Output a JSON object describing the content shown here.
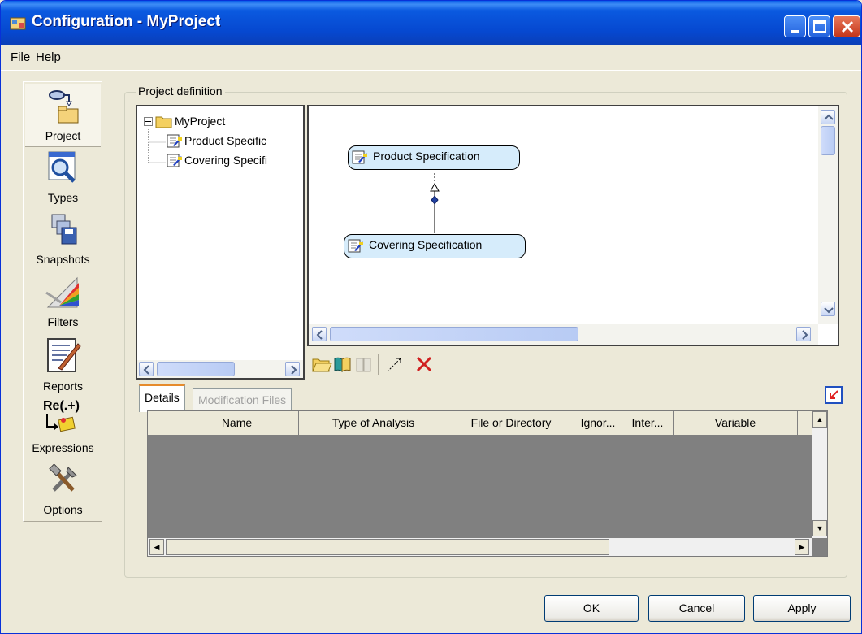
{
  "window": {
    "title": "Configuration - MyProject"
  },
  "menu": {
    "file": "File",
    "help": "Help"
  },
  "sidebar": {
    "items": [
      {
        "label": "Project",
        "icon": "project-icon",
        "active": true
      },
      {
        "label": "Types",
        "icon": "types-icon"
      },
      {
        "label": "Snapshots",
        "icon": "snapshots-icon"
      },
      {
        "label": "Filters",
        "icon": "filters-icon"
      },
      {
        "label": "Reports",
        "icon": "reports-icon"
      },
      {
        "label": "Expressions",
        "icon": "expressions-icon",
        "icon_text": "Re(.+)"
      },
      {
        "label": "Options",
        "icon": "options-icon"
      }
    ]
  },
  "project_definition": {
    "label": "Project definition",
    "tree": {
      "root": "MyProject",
      "children": [
        "Product Specific",
        "Covering Specifi"
      ]
    },
    "diagram": {
      "nodes": [
        "Product Specification",
        "Covering Specification"
      ]
    },
    "toolbar": [
      "open-folder-icon",
      "open-book-icon",
      "book-disabled-icon",
      "link-icon",
      "delete-icon"
    ]
  },
  "tabs": [
    "Details",
    "Modification Files"
  ],
  "grid": {
    "columns": [
      "Name",
      "Type of Analysis",
      "File or Directory",
      "Ignor...",
      "Inter...",
      "Variable"
    ]
  },
  "buttons": {
    "ok": "OK",
    "cancel": "Cancel",
    "apply": "Apply"
  }
}
